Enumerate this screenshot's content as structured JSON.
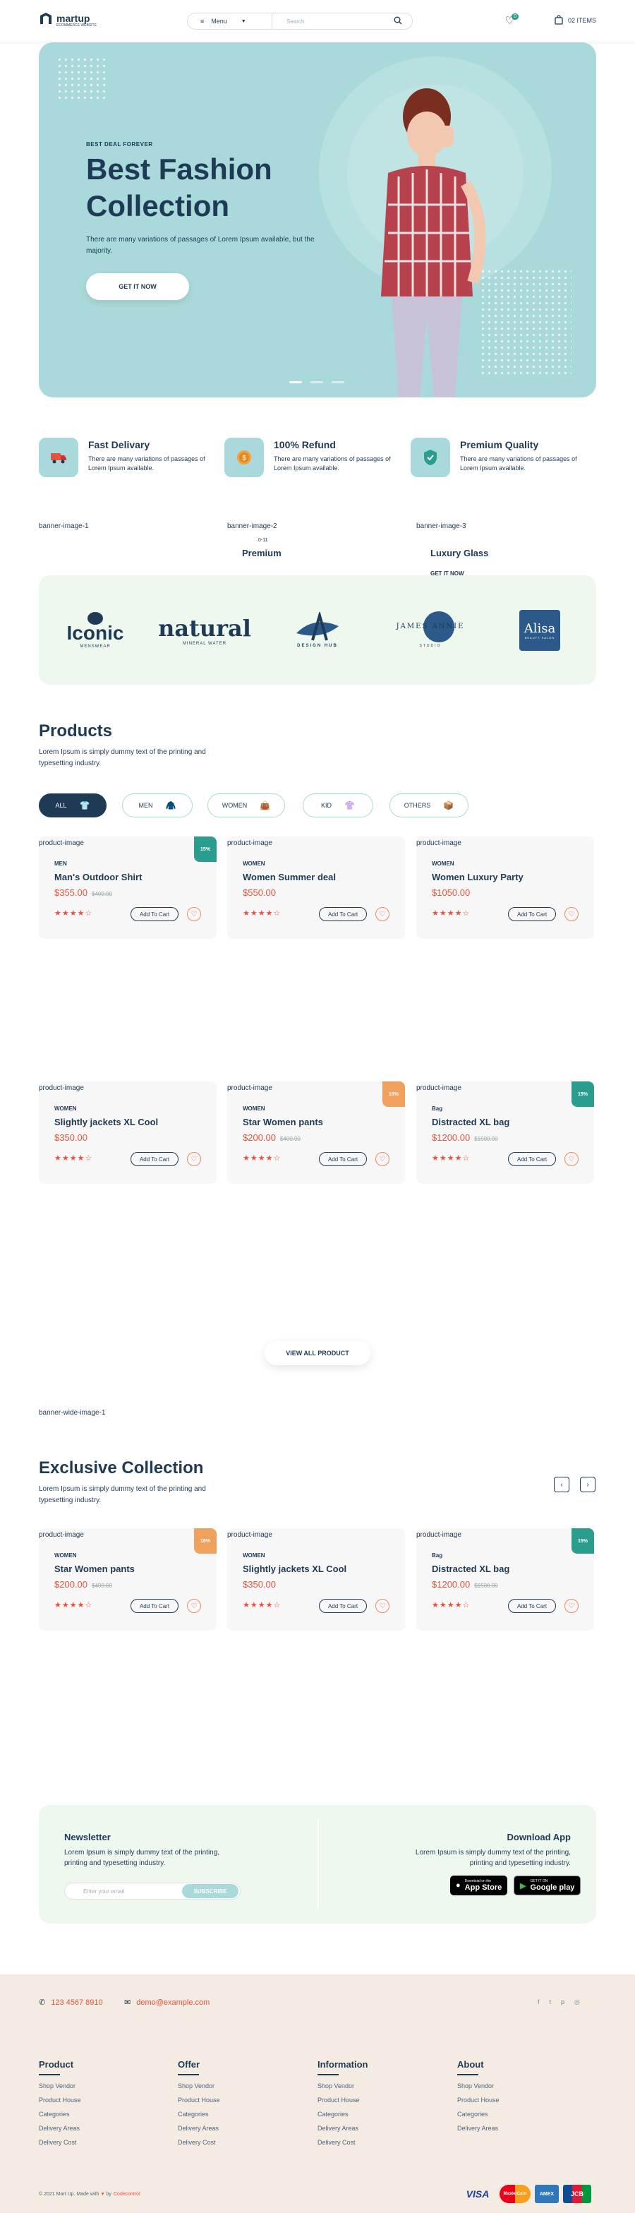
{
  "header": {
    "logo_title": "martup",
    "logo_subtitle": "ECOMMERCE WEBSITE",
    "menu_label": "Menu",
    "search_placeholder": "Search",
    "wishlist_count": "0",
    "cart_label": "02 ITEMS"
  },
  "hero": {
    "kicker": "BEST DEAL FOREVER",
    "title": "Best Fashion Collection",
    "description": "There are many variations of passages of Lorem Ipsum available, but the majority.",
    "button": "GET IT NOW"
  },
  "features": [
    {
      "title": "Fast Delivary",
      "text": "There are many variations of passages of Lorem Ipsum available.",
      "icon": "truck-icon"
    },
    {
      "title": "100% Refund",
      "text": "There are many variations of passages of Lorem Ipsum available.",
      "icon": "coin-icon"
    },
    {
      "title": "Premium Quality",
      "text": "There are many variations of passages of Lorem Ipsum available.",
      "icon": "shield-check-icon"
    }
  ],
  "banners": {
    "b1": "banner-image-1",
    "b2": "banner-image-2",
    "b2_sub": "0-11",
    "b2_title": "Premium",
    "b3": "banner-image-3",
    "b3_title": "Luxury Glass",
    "b3_button": "GET IT NOW"
  },
  "brands": {
    "b1": "Iconic",
    "b1_sub": "MENSWEAR",
    "b2": "natural",
    "b2_sub": "MINERAL WATER",
    "b3_sub": "DESIGN HUB",
    "b4": "JAMES ANNIE",
    "b4_sub": "STUDIO",
    "b5": "Alisa",
    "b5_sub": "BEAUTY SALON"
  },
  "products": {
    "title": "Products",
    "description": "Lorem Ipsum is simply dummy text of the printing and typesetting industry.",
    "filters": [
      {
        "label": "ALL",
        "icon": "shirt-icon"
      },
      {
        "label": "MEN",
        "icon": "jacket-icon"
      },
      {
        "label": "WOMEN",
        "icon": "bag-icon"
      },
      {
        "label": "KID",
        "icon": "tshirt-icon"
      },
      {
        "label": "OTHERS",
        "icon": "boxes-icon"
      }
    ],
    "items": [
      {
        "img": "product-image",
        "discount": "15%",
        "category": "MEN",
        "name": "Man's Outdoor Shirt",
        "price": "$355.00",
        "old": "$400.00",
        "stars": "★★★★☆",
        "cart": "Add To Cart"
      },
      {
        "img": "product-image",
        "discount": "",
        "category": "WOMEN",
        "name": "Women Summer deal",
        "price": "$550.00",
        "old": "",
        "stars": "★★★★☆",
        "cart": "Add To Cart"
      },
      {
        "img": "product-image",
        "discount": "",
        "category": "WOMEN",
        "name": "Women Luxury Party",
        "price": "$1050.00",
        "old": "",
        "stars": "★★★★☆",
        "cart": "Add To Cart"
      },
      {
        "img": "product-image",
        "discount": "",
        "category": "WOMEN",
        "name": "Slightly jackets XL Cool",
        "price": "$350.00",
        "old": "",
        "stars": "★★★★☆",
        "cart": "Add To Cart"
      },
      {
        "img": "product-image",
        "discount": "15%",
        "category": "WOMEN",
        "name": "Star Women pants",
        "price": "$200.00",
        "old": "$400.00",
        "stars": "★★★★☆",
        "cart": "Add To Cart"
      },
      {
        "img": "product-image",
        "discount": "15%",
        "category": "Bag",
        "name": "Distracted XL bag",
        "price": "$1200.00",
        "old": "$1500.00",
        "stars": "★★★★☆",
        "cart": "Add To Cart"
      }
    ],
    "view_all": "VIEW ALL PRODUCT"
  },
  "wide_banner": "banner-wide-image-1",
  "exclusive": {
    "title": "Exclusive Collection",
    "description": "Lorem Ipsum is simply dummy text of the printing and typesetting industry.",
    "prev": "‹",
    "next": "›",
    "items": [
      {
        "img": "product-image",
        "discount": "15%",
        "category": "WOMEN",
        "name": "Star Women pants",
        "price": "$200.00",
        "old": "$400.00",
        "stars": "★★★★☆",
        "cart": "Add To Cart"
      },
      {
        "img": "product-image",
        "discount": "",
        "category": "WOMEN",
        "name": "Slightly jackets XL Cool",
        "price": "$350.00",
        "old": "",
        "stars": "★★★★☆",
        "cart": "Add To Cart"
      },
      {
        "img": "product-image",
        "discount": "15%",
        "category": "Bag",
        "name": "Distracted XL bag",
        "price": "$1200.00",
        "old": "$1500.00",
        "stars": "★★★★☆",
        "cart": "Add To Cart"
      }
    ]
  },
  "newsletter": {
    "title": "Newsletter",
    "text": "Lorem Ipsum is simply dummy text of the printing, printing and typesetting industry.",
    "placeholder": "Enter your email",
    "button": "SUBSCRIBE",
    "app_title": "Download App",
    "app_text": "Lorem Ipsum is simply dummy text of the printing, printing and typesetting industry.",
    "appstore_small": "Download on the",
    "appstore": "App Store",
    "gplay_small": "GET IT ON",
    "gplay": "Google play"
  },
  "footer": {
    "phone": "123 4567 8910",
    "email": "demo@example.com",
    "columns": [
      {
        "title": "Product",
        "links": [
          "Shop Vendor",
          "Product House",
          "Categories",
          "Delivery Areas",
          "Delivery Cost"
        ]
      },
      {
        "title": "Offer",
        "links": [
          "Shop Vendor",
          "Product House",
          "Categories",
          "Delivery Areas",
          "Delivery Cost"
        ]
      },
      {
        "title": "Information",
        "links": [
          "Shop Vendor",
          "Product House",
          "Categories",
          "Delivery Areas",
          "Delivery Cost"
        ]
      },
      {
        "title": "About",
        "links": [
          "Shop Vendor",
          "Product House",
          "Categories",
          "Delivery Areas"
        ]
      }
    ],
    "copyright_a": "© 2021 Mart Up. Made with",
    "copyright_b": "by",
    "copyright_c": "Codecontrol",
    "pay": {
      "visa": "VISA",
      "mc": "MasterCard",
      "amex": "AMEX",
      "jcb": "JCB"
    }
  },
  "colors": {
    "navy": "#1e3a55",
    "teal": "#a9d9da",
    "red": "#e5533d",
    "green_badge": "#2a9d8f",
    "orange_badge": "#f0a15d"
  }
}
